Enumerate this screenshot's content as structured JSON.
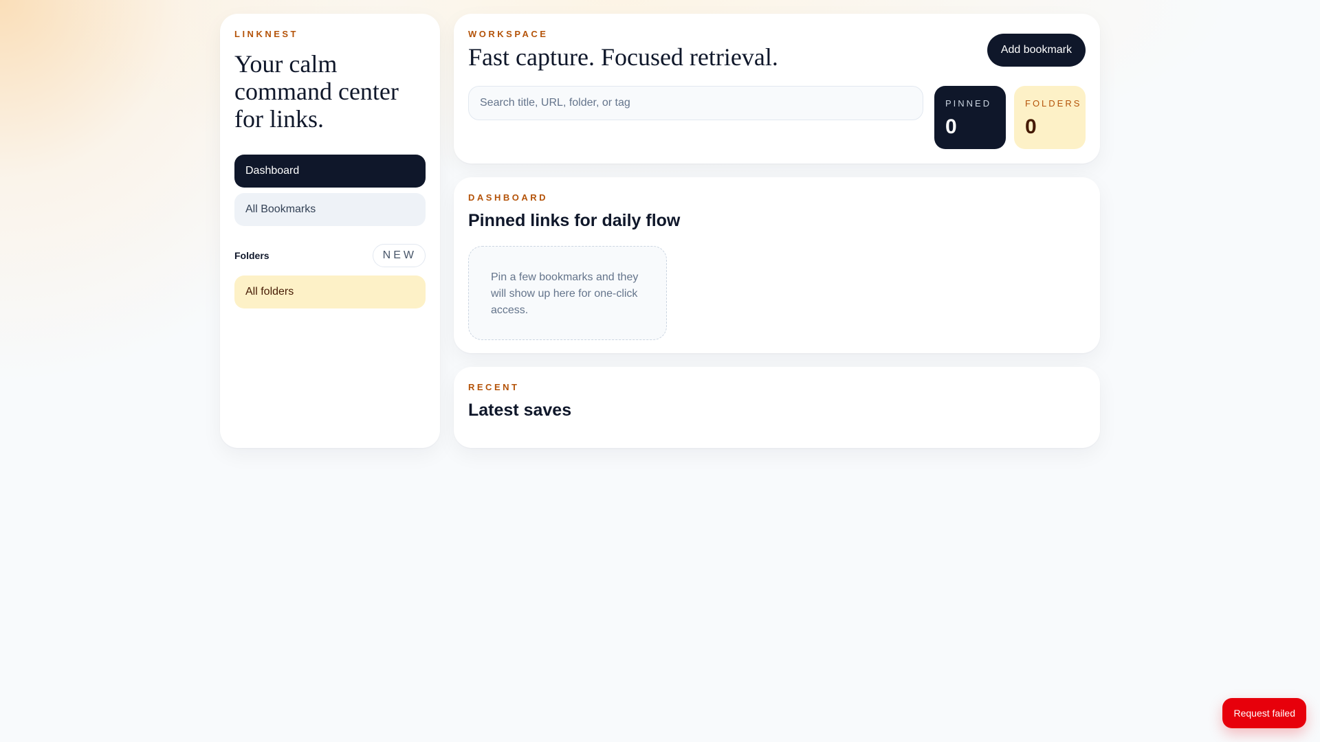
{
  "sidebar": {
    "brand": "LINKNEST",
    "hero_title": "Your calm command center for links.",
    "nav": [
      {
        "label": "Dashboard",
        "active": true
      },
      {
        "label": "All Bookmarks",
        "active": false
      }
    ],
    "folders_label": "Folders",
    "new_label": "NEW",
    "folder_items": [
      {
        "label": "All folders"
      }
    ]
  },
  "workspace": {
    "eyebrow": "WORKSPACE",
    "title": "Fast capture. Focused retrieval.",
    "add_button": "Add bookmark",
    "search_placeholder": "Search title, URL, folder, or tag",
    "search_value": "",
    "stats": {
      "pinned_label": "PINNED",
      "pinned_value": "0",
      "folders_label": "FOLDERS",
      "folders_value": "0"
    }
  },
  "dashboard": {
    "eyebrow": "DASHBOARD",
    "title": "Pinned links for daily flow",
    "empty_text": "Pin a few bookmarks and they will show up here for one-click access."
  },
  "recent": {
    "eyebrow": "RECENT",
    "title": "Latest saves"
  },
  "toast": {
    "message": "Request failed"
  },
  "colors": {
    "accent": "#b45309",
    "dark": "#0f172a",
    "amber_bg": "#fdf1c7",
    "error": "#e7000b"
  }
}
